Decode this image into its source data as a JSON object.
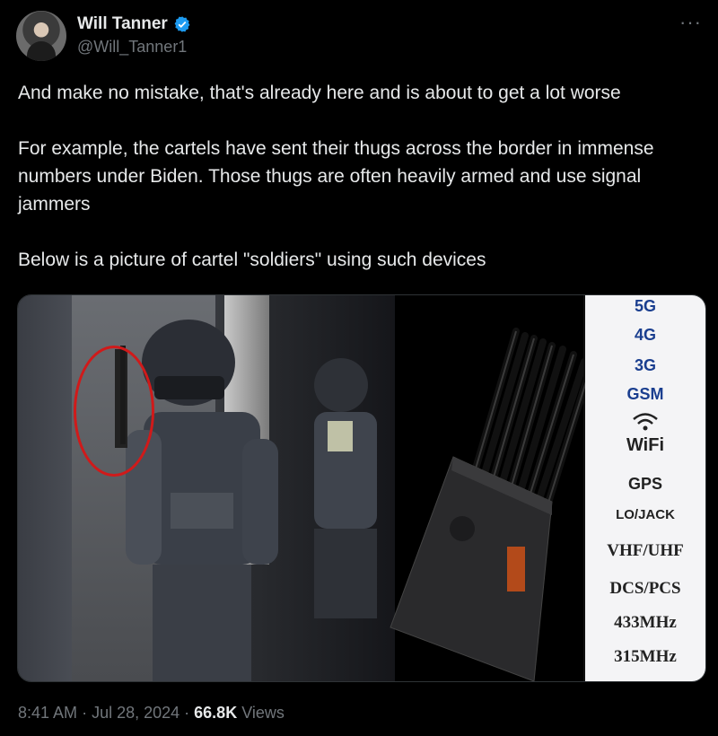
{
  "author": {
    "name": "Will Tanner",
    "handle": "@Will_Tanner1",
    "verified": true
  },
  "more_label": "···",
  "tweet": {
    "paragraphs": [
      "And make no mistake, that's already here and is about to get a lot worse",
      "For example, the cartels have sent their thugs across the border in immense numbers under Biden. Those thugs are often heavily armed and use signal jammers",
      "Below is a picture of cartel \"soldiers\" using such devices"
    ]
  },
  "media": {
    "bands": [
      "5G",
      "4G",
      "3G",
      "GSM",
      "WiFi",
      "GPS",
      "LO/JACK",
      "VHF/UHF",
      "DCS/PCS",
      "433MHz",
      "315MHz"
    ]
  },
  "meta": {
    "time": "8:41 AM",
    "date": "Jul 28, 2024",
    "views_count": "66.8K",
    "views_label": "Views"
  },
  "colors": {
    "background": "#000000",
    "text": "#e7e9ea",
    "secondary": "#71767b",
    "verified": "#1d9bf0",
    "annotation_circle": "#d01a1a"
  }
}
